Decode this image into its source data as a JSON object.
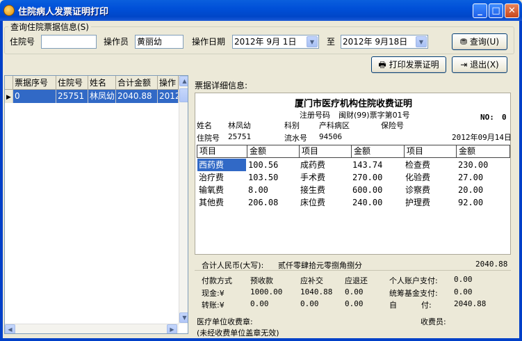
{
  "window": {
    "title": "住院病人发票证明打印",
    "minimize": "_",
    "maximize": "□",
    "close": "✕"
  },
  "query": {
    "group_label": "查询住院票据信息(S)",
    "inpatient_no_label": "住院号",
    "inpatient_no_value": "",
    "operator_label": "操作员",
    "operator_value": "黄丽幼",
    "date_label": "操作日期",
    "date_from": "2012年 9月 1日",
    "to_label": "至",
    "date_to": "2012年 9月18日",
    "search_button": "查询(U)"
  },
  "actions": {
    "print_button": "打印发票证明",
    "exit_button": "退出(X)"
  },
  "grid": {
    "columns": [
      "票据序号",
      "住院号",
      "姓名",
      "合计金额",
      "操作"
    ],
    "rows": [
      {
        "serial": "0",
        "inpatient_no": "25751",
        "name": "林凤幼",
        "total": "2040.88",
        "op": "2012"
      }
    ]
  },
  "detail": {
    "label": "票据详细信息:",
    "title": "厦门市医疗机构住院收费证明",
    "reg_label": "注册号码",
    "reg_value": "闽财(99)票字第01号",
    "no_label": "NO:",
    "no_value": "0",
    "name_label": "姓名",
    "name_value": "林凤幼",
    "dept_label": "科别",
    "dept_value": "产科病区",
    "insurance_label": "保险号",
    "inpatient_label": "住院号",
    "inpatient_value": "25751",
    "serial_label": "流水号",
    "serial_value": "94506",
    "date": "2012年09月14日",
    "table_headers": [
      "项目",
      "金额",
      "项目",
      "金额",
      "项目",
      "金额"
    ],
    "items": [
      [
        "西药费",
        "100.56",
        "成药费",
        "143.74",
        "检查费",
        "230.00"
      ],
      [
        "治疗费",
        "103.50",
        "手术费",
        "270.00",
        "化验费",
        "27.00"
      ],
      [
        "输氧费",
        "8.00",
        "接生费",
        "600.00",
        "诊察费",
        "20.00"
      ],
      [
        "其他费",
        "206.08",
        "床位费",
        "240.00",
        "护理费",
        "92.00"
      ]
    ]
  },
  "summary": {
    "total_label": "合计人民币(大写):",
    "total_words": "贰仟零肆拾元零捌角捌分",
    "total_value": "2040.88",
    "pay_method": "付款方式",
    "prepaid": "预收款",
    "supplement": "应补交",
    "refund": "应退还",
    "personal_label": "个人账户支付:",
    "personal_value": "0.00",
    "cash_label": "现金:¥",
    "cash_prepaid": "1000.00",
    "cash_supplement": "1040.88",
    "cash_refund": "0.00",
    "pool_label": "统筹基金支付:",
    "pool_value": "0.00",
    "transfer_label": "转账:¥",
    "transfer_prepaid": "0.00",
    "transfer_supplement": "0.00",
    "transfer_refund": "0.00",
    "self_label": "自          付:",
    "self_value": "2040.88",
    "seal_label": "医疗单位收费章:",
    "collector_label": "收费员:",
    "note": "(未经收费单位盖章无效)"
  },
  "icons": {
    "search": "binoculars-icon",
    "print": "printer-icon",
    "exit": "exit-door-icon"
  }
}
